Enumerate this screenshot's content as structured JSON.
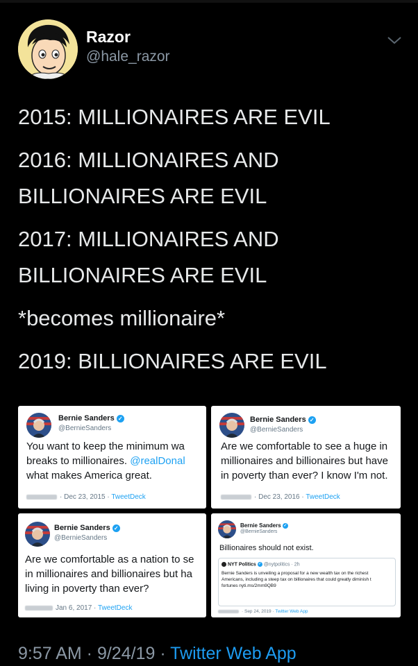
{
  "profile": {
    "name": "Razor",
    "handle": "@hale_razor"
  },
  "tweet_lines": [
    "2015: MILLIONAIRES ARE EVIL",
    "2016: MILLIONAIRES AND",
    "BILLIONAIRES ARE EVIL",
    "2017: MILLIONAIRES AND",
    "BILLIONAIRES ARE EVIL",
    "*becomes millionaire*",
    "2019: BILLIONAIRES ARE EVIL"
  ],
  "cards": [
    {
      "name": "Bernie Sanders",
      "handle": "@BernieSanders",
      "lines": [
        "You want to keep the minimum wa",
        "breaks to millionaires. ",
        "what makes America great."
      ],
      "mention": "@realDonal",
      "date": "Dec 23, 2015",
      "client": "TweetDeck"
    },
    {
      "name": "Bernie Sanders",
      "handle": "@BernieSanders",
      "lines": [
        "Are we comfortable to see a huge in",
        "millionaires and billionaires but have",
        "in poverty than ever? I know I'm not."
      ],
      "date": "Dec 23, 2016",
      "client": "TweetDeck"
    },
    {
      "name": "Bernie Sanders",
      "handle": "@BernieSanders",
      "lines": [
        "Are we comfortable as a nation to se",
        "in millionaires and billionaires but ha",
        "living in poverty than ever?"
      ],
      "date": "Jan 6, 2017",
      "client": "TweetDeck"
    },
    {
      "name": "Bernie Sanders",
      "handle": "@BernieSanders",
      "lines": [
        "Billionaires should not exist."
      ],
      "quote": {
        "name": "NYT Politics",
        "handle": "@nytpolitics",
        "time": "2h",
        "lines": [
          "Bernie Sanders is unveiling a proposal for a new wealth tax on the richest",
          "Americans, including a steep tax on billionaires that could greatly diminish t",
          "fortunes nyti.ms/2mm9QB9"
        ]
      },
      "date": "Sep 24, 2019",
      "client": "Twitter Web App"
    }
  ],
  "footer": {
    "time": "9:57 AM",
    "date": "9/24/19",
    "app": "Twitter Web App",
    "separator": " · "
  },
  "icons": {
    "more": "chevron-down-icon",
    "verified": "verified-badge-icon"
  },
  "colors": {
    "background": "#000000",
    "link": "#1d9bf0",
    "muted": "#8b98a5"
  }
}
